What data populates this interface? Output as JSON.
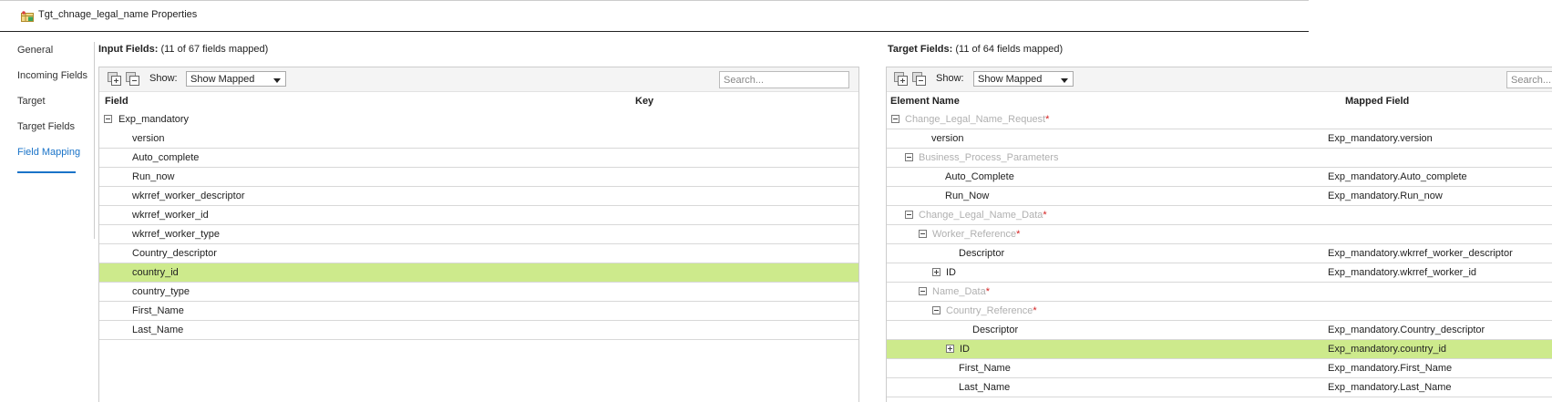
{
  "window": {
    "title": "Tgt_chnage_legal_name Properties"
  },
  "nav": {
    "items": [
      "General",
      "Incoming Fields",
      "Target",
      "Target Fields",
      "Field Mapping"
    ],
    "active": "Field Mapping"
  },
  "input_panel": {
    "heading": "Input Fields:",
    "count": "(11 of 67 fields mapped)",
    "show_label": "Show:",
    "show_value": "Show Mapped",
    "search_placeholder": "Search...",
    "col_field": "Field",
    "col_key": "Key",
    "rows": [
      {
        "field": "Exp_mandatory",
        "level": 0,
        "toggle": "minus"
      },
      {
        "field": "version",
        "level": 1
      },
      {
        "field": "Auto_complete",
        "level": 1
      },
      {
        "field": "Run_now",
        "level": 1
      },
      {
        "field": "wkrref_worker_descriptor",
        "level": 1
      },
      {
        "field": "wkrref_worker_id",
        "level": 1
      },
      {
        "field": "wkrref_worker_type",
        "level": 1
      },
      {
        "field": "Country_descriptor",
        "level": 1
      },
      {
        "field": "country_id",
        "level": 1,
        "highlight": true
      },
      {
        "field": "country_type",
        "level": 1
      },
      {
        "field": "First_Name",
        "level": 1
      },
      {
        "field": "Last_Name",
        "level": 1
      }
    ]
  },
  "target_panel": {
    "heading": "Target Fields:",
    "count": "(11 of 64 fields mapped)",
    "show_label": "Show:",
    "show_value": "Show Mapped",
    "search_placeholder": "Search...",
    "col_element": "Element Name",
    "col_mapped": "Mapped Field",
    "rows": [
      {
        "name": "Change_Legal_Name_Request",
        "level": 0,
        "toggle": "minus",
        "group": true,
        "required": "*",
        "mapped": ""
      },
      {
        "name": "version",
        "level": 1,
        "mapped": "Exp_mandatory.version"
      },
      {
        "name": "Business_Process_Parameters",
        "level": 1,
        "toggle": "minus",
        "group": true,
        "mapped": ""
      },
      {
        "name": "Auto_Complete",
        "level": 2,
        "mapped": "Exp_mandatory.Auto_complete"
      },
      {
        "name": "Run_Now",
        "level": 2,
        "mapped": "Exp_mandatory.Run_now"
      },
      {
        "name": "Change_Legal_Name_Data",
        "level": 1,
        "toggle": "minus",
        "group": true,
        "required": "*",
        "mapped": ""
      },
      {
        "name": "Worker_Reference",
        "level": 2,
        "toggle": "minus",
        "group": true,
        "required": "*",
        "mapped": ""
      },
      {
        "name": "Descriptor",
        "level": 3,
        "mapped": "Exp_mandatory.wkrref_worker_descriptor"
      },
      {
        "name": "ID",
        "level": 3,
        "toggle": "plus",
        "mapped": "Exp_mandatory.wkrref_worker_id"
      },
      {
        "name": "Name_Data",
        "level": 2,
        "toggle": "minus",
        "group": true,
        "required": "*",
        "mapped": ""
      },
      {
        "name": "Country_Reference",
        "level": 3,
        "toggle": "minus",
        "group": true,
        "required": "*",
        "mapped": ""
      },
      {
        "name": "Descriptor",
        "level": 4,
        "mapped": "Exp_mandatory.Country_descriptor"
      },
      {
        "name": "ID",
        "level": 4,
        "toggle": "plus",
        "highlight": true,
        "mapped": "Exp_mandatory.country_id"
      },
      {
        "name": "First_Name",
        "level": 3,
        "mapped": "Exp_mandatory.First_Name"
      },
      {
        "name": "Last_Name",
        "level": 3,
        "mapped": "Exp_mandatory.Last_Name"
      }
    ]
  },
  "colors": {
    "accent": "#1a73c8",
    "highlight": "#cdea8c",
    "required": "#d42020",
    "muted": "#b0b0b0"
  }
}
